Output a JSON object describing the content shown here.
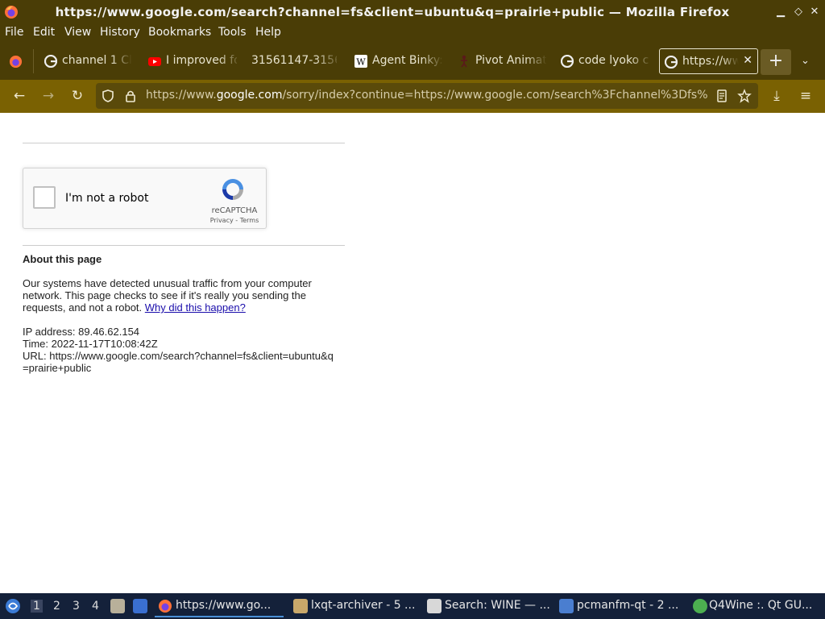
{
  "window": {
    "title": "https://www.google.com/search?channel=fs&client=ubuntu&q=prairie+public — Mozilla Firefox",
    "minimize": "▁",
    "restore": "◇",
    "close": "✕"
  },
  "menu": [
    "File",
    "Edit",
    "View",
    "History",
    "Bookmarks",
    "Tools",
    "Help"
  ],
  "tabs": [
    {
      "label": "channel 1 Cl",
      "icon": "google-icon"
    },
    {
      "label": "I improved fo",
      "icon": "youtube-icon"
    },
    {
      "label": "31561147-3156",
      "icon": ""
    },
    {
      "label": "Agent Binky:",
      "icon": "wikipedia-icon"
    },
    {
      "label": "Pivot Animat",
      "icon": "stickfigure-icon"
    },
    {
      "label": "code lyoko cl",
      "icon": "google-icon"
    },
    {
      "label": "https://www",
      "icon": "google-icon",
      "active": true
    }
  ],
  "tab_close": "✕",
  "new_tab": "+",
  "tab_list": "⌄",
  "nav": {
    "back": "←",
    "forward": "→",
    "reload": "↻",
    "url_prefix": "https://www.",
    "url_host": "google.com",
    "url_rest": "/sorry/index?continue=https://www.google.com/search%3Fchannel%3Dfs%",
    "download": "⤓",
    "menu": "≡"
  },
  "page": {
    "recaptcha_label": "I'm not a robot",
    "recaptcha_brand": "reCAPTCHA",
    "recaptcha_links": "Privacy - Terms",
    "about_title": "About this page",
    "para_text": "Our systems have detected unusual traffic from your computer network. This page checks to see if it's really you sending the requests, and not a robot.",
    "para_link": "Why did this happen?",
    "ip": "IP address: 89.46.62.154",
    "time": "Time: 2022-11-17T10:08:42Z",
    "url": "URL: https://www.google.com/search?channel=fs&client=ubuntu&q=prairie+public"
  },
  "taskbar": {
    "desktops": [
      "1",
      "2",
      "3",
      "4"
    ],
    "tasks": [
      {
        "label": "https://www.go...",
        "icon": "firefox-icon",
        "active": true
      },
      {
        "label": "lxqt-archiver - 5 ...",
        "icon": "archiver-icon"
      },
      {
        "label": "Search: WINE — ...",
        "icon": "search-app-icon"
      },
      {
        "label": "pcmanfm-qt - 2 ...",
        "icon": "folder-icon"
      },
      {
        "label": "Q4Wine :. Qt GU...",
        "icon": "q4wine-icon"
      }
    ]
  },
  "colors": {
    "chrome": "#4a3d06",
    "navbar": "#7a6102",
    "link": "#1a0dab",
    "taskbar": "#14213a"
  }
}
